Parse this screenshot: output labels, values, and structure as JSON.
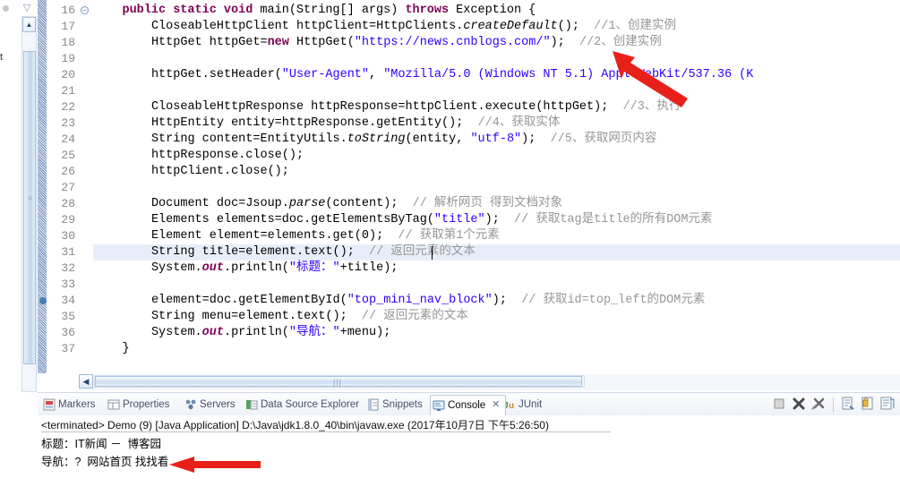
{
  "window": {
    "left_edge_label": "t"
  },
  "editor": {
    "first_line_number": 16,
    "current_line": 31,
    "breakpoint_line": 34,
    "fold_line": 16,
    "lines": [
      {
        "n": 16,
        "indent": 4,
        "html": "<span class=\"kw\">public</span> <span class=\"kw\">static</span> <span class=\"kw\">void</span> main(String[] args) <span class=\"kw\">throws</span> Exception {"
      },
      {
        "n": 17,
        "indent": 8,
        "html": "CloseableHttpClient httpClient=HttpClients.<span class=\"mi\">createDefault</span>();  <span class=\"cmt\">//1、创建实例</span>"
      },
      {
        "n": 18,
        "indent": 8,
        "html": "HttpGet httpGet=<span class=\"kw\">new</span> HttpGet(<span class=\"str\">\"https://news.cnblogs.com/\"</span>);  <span class=\"cmt\">//2、创建实例</span>"
      },
      {
        "n": 19,
        "indent": 0,
        "html": ""
      },
      {
        "n": 20,
        "indent": 8,
        "html": "httpGet.setHeader(<span class=\"str\">\"User-Agent\"</span>, <span class=\"str\">\"Mozilla/5.0 (Windows NT 5.1) AppleWebKit/537.36 (K</span>"
      },
      {
        "n": 21,
        "indent": 0,
        "html": ""
      },
      {
        "n": 22,
        "indent": 8,
        "html": "CloseableHttpResponse httpResponse=httpClient.execute(httpGet);  <span class=\"cmt\">//3、执行</span>"
      },
      {
        "n": 23,
        "indent": 8,
        "html": "HttpEntity entity=httpResponse.getEntity();  <span class=\"cmt\">//4、获取实体</span>"
      },
      {
        "n": 24,
        "indent": 8,
        "html": "String content=EntityUtils.<span class=\"mi\">toString</span>(entity, <span class=\"str\">\"utf-8\"</span>);  <span class=\"cmt\">//5、获取网页内容</span>"
      },
      {
        "n": 25,
        "indent": 8,
        "html": "httpResponse.close();"
      },
      {
        "n": 26,
        "indent": 8,
        "html": "httpClient.close();"
      },
      {
        "n": 27,
        "indent": 0,
        "html": ""
      },
      {
        "n": 28,
        "indent": 8,
        "html": "Document doc=Jsoup.<span class=\"mi\">parse</span>(content);  <span class=\"cmt\">// 解析网页 得到文档对象</span>"
      },
      {
        "n": 29,
        "indent": 8,
        "html": "Elements elements=doc.getElementsByTag(<span class=\"str\">\"title\"</span>);  <span class=\"cmt\">// 获取tag是title的所有DOM元素</span>"
      },
      {
        "n": 30,
        "indent": 8,
        "html": "Element element=elements.get(0);  <span class=\"cmt\">// 获取第1个元素</span>"
      },
      {
        "n": 31,
        "indent": 8,
        "html": "String title=element.text();  <span class=\"cmt\">// 返回元素的文本</span>"
      },
      {
        "n": 32,
        "indent": 8,
        "html": "System.<span class=\"kwi\">out</span>.println(<span class=\"str\">\"标题：\"</span>+title);"
      },
      {
        "n": 33,
        "indent": 0,
        "html": ""
      },
      {
        "n": 34,
        "indent": 8,
        "html": "element=doc.getElementById(<span class=\"str\">\"top_mini_nav_block\"</span>);  <span class=\"cmt\">// 获取id=top_left的DOM元素</span>"
      },
      {
        "n": 35,
        "indent": 8,
        "html": "String menu=element.text();  <span class=\"cmt\">// 返回元素的文本</span>"
      },
      {
        "n": 36,
        "indent": 8,
        "html": "System.<span class=\"kwi\">out</span>.println(<span class=\"str\">\"导航：\"</span>+menu);"
      },
      {
        "n": 37,
        "indent": 4,
        "html": "}"
      }
    ],
    "lines_plain": [
      "public static void main(String[] args) throws Exception {",
      "CloseableHttpClient httpClient=HttpClients.createDefault();  //1、创建实例",
      "HttpGet httpGet=new HttpGet(\"https://news.cnblogs.com/\");  //2、创建实例",
      "",
      "httpGet.setHeader(\"User-Agent\", \"Mozilla/5.0 (Windows NT 5.1) AppleWebKit/537.36 (K",
      "",
      "CloseableHttpResponse httpResponse=httpClient.execute(httpGet);  //3、执行",
      "HttpEntity entity=httpResponse.getEntity();  //4、获取实体",
      "String content=EntityUtils.toString(entity, \"utf-8\");  //5、获取网页内容",
      "httpResponse.close();",
      "httpClient.close();",
      "",
      "Document doc=Jsoup.parse(content);  // 解析网页 得到文档对象",
      "Elements elements=doc.getElementsByTag(\"title\");  // 获取tag是title的所有DOM元素",
      "Element element=elements.get(0);  // 获取第1个元素",
      "String title=element.text();  // 返回元素的文本",
      "System.out.println(\"标题：\"+title);",
      "",
      "element=doc.getElementById(\"top_mini_nav_block\");  // 获取id=top_left的DOM元素",
      "String menu=element.text();  // 返回元素的文本",
      "System.out.println(\"导航：\"+menu);",
      "}"
    ],
    "colors": {
      "keyword": "#7f0055",
      "string": "#2a00ff",
      "comment": "#969696",
      "text": "#000000",
      "current_line_highlight": "#e8eef9",
      "annotation_ruler": "#5577aa"
    }
  },
  "bottom_panel": {
    "tabs": [
      {
        "id": "markers",
        "label": "Markers",
        "icon": "markers-icon",
        "active": false
      },
      {
        "id": "properties",
        "label": "Properties",
        "icon": "properties-icon",
        "active": false
      },
      {
        "id": "servers",
        "label": "Servers",
        "icon": "servers-icon",
        "active": false
      },
      {
        "id": "data-source-explorer",
        "label": "Data Source Explorer",
        "icon": "database-icon",
        "active": false
      },
      {
        "id": "snippets",
        "label": "Snippets",
        "icon": "snippets-icon",
        "active": false
      },
      {
        "id": "console",
        "label": "Console",
        "icon": "console-icon",
        "active": true,
        "close_glyph": "✕"
      },
      {
        "id": "junit",
        "label": "JUnit",
        "icon": "junit-icon",
        "active": false
      }
    ],
    "toolbar_icons": [
      {
        "id": "terminate",
        "name": "stop-icon",
        "glyph": "■"
      },
      {
        "id": "remove-launch",
        "name": "remove-terminated-icon",
        "glyph": "✖"
      },
      {
        "id": "remove-all-launches",
        "name": "remove-all-terminated-icon",
        "glyph": "✖"
      },
      {
        "id": "open-console",
        "name": "open-console-icon",
        "glyph": "▤"
      },
      {
        "id": "pin-console",
        "name": "pin-console-icon",
        "glyph": "▦"
      },
      {
        "id": "display-selected-console",
        "name": "display-selected-console-icon",
        "glyph": "▥"
      }
    ],
    "console": {
      "header": "<terminated> Demo (9) [Java Application] D:\\Java\\jdk1.8.0_40\\bin\\javaw.exe (2017年10月7日 下午5:26:50)",
      "output_lines": [
        "标题：IT新闻 －  博客园",
        "导航：?  网站首页 找找看"
      ]
    }
  },
  "annotations": {
    "arrow_color": "#e8201a",
    "arrows": [
      {
        "id": "arrow-to-url",
        "target": "line-18-url",
        "note": "points to https://news.cnblogs.com/"
      },
      {
        "id": "arrow-to-nav-output",
        "target": "console-nav-line",
        "note": "points to 导航 output line"
      }
    ]
  }
}
